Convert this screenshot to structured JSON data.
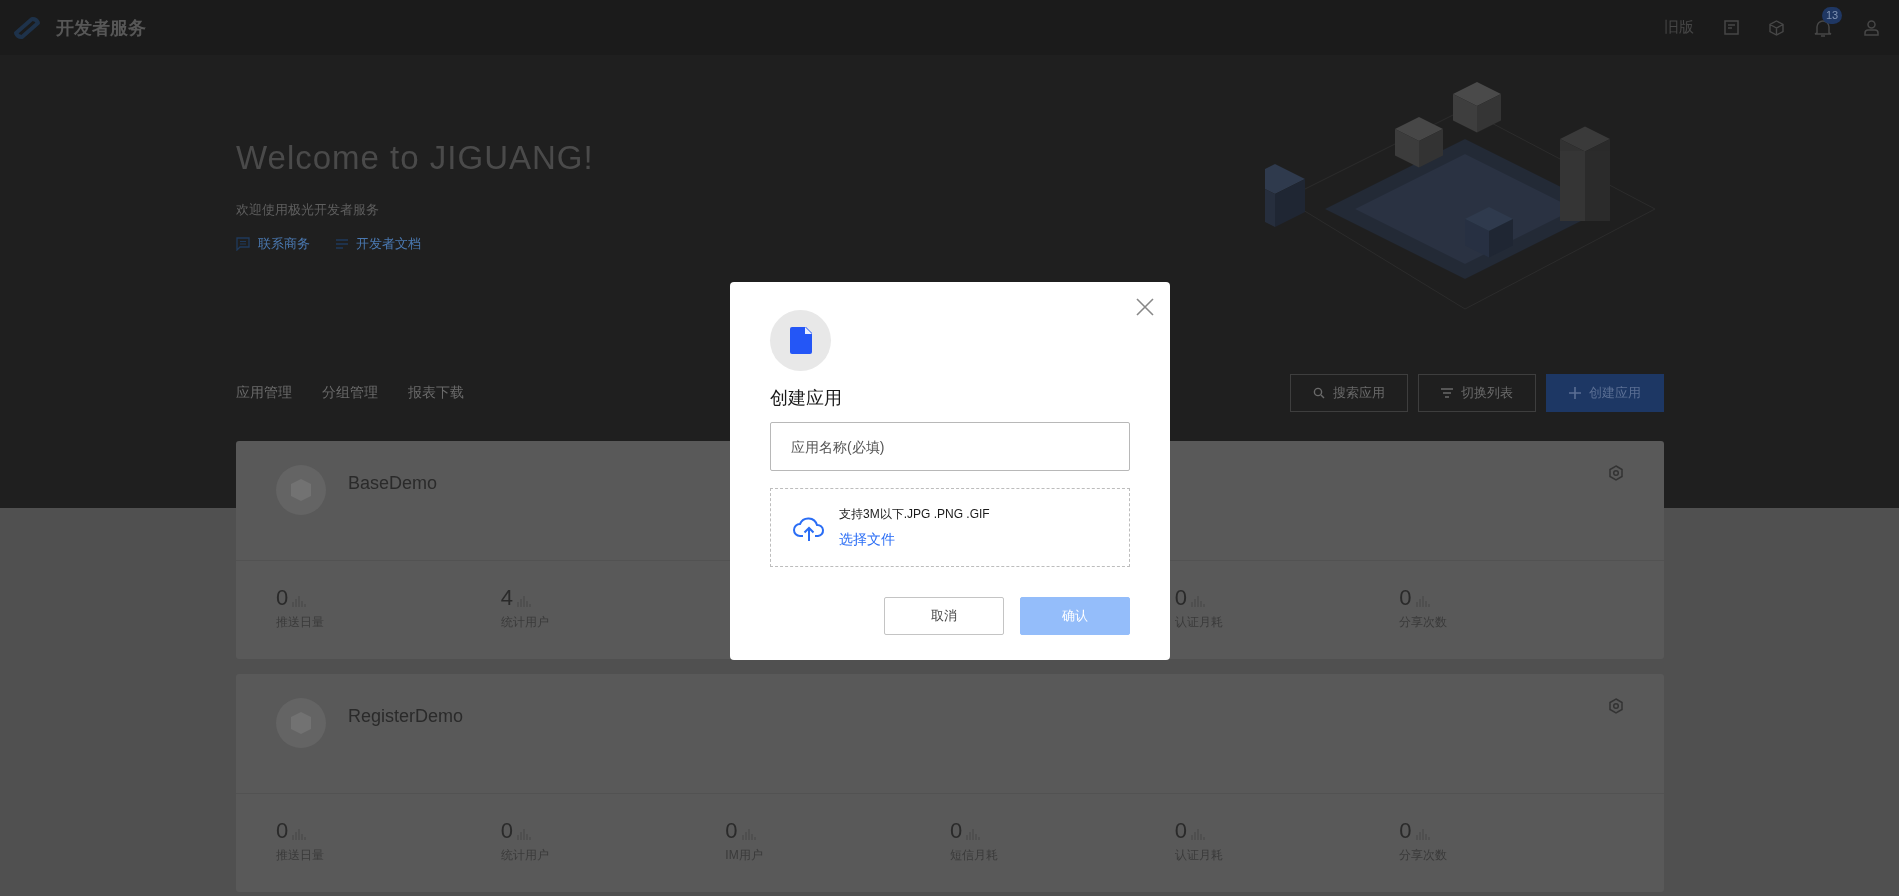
{
  "topbar": {
    "title": "开发者服务",
    "old_version": "旧版",
    "notification_count": "13"
  },
  "hero": {
    "title": "Welcome to JIGUANG!",
    "subtitle": "欢迎使用极光开发者服务",
    "links": [
      {
        "label": "联系商务",
        "kind": "chat"
      },
      {
        "label": "开发者文档",
        "kind": "doc"
      }
    ]
  },
  "tabs": [
    "应用管理",
    "分组管理",
    "报表下载"
  ],
  "actions": [
    {
      "label": "搜索应用",
      "kind": "search"
    },
    {
      "label": "切换列表",
      "kind": "list"
    },
    {
      "label": "创建应用",
      "kind": "create"
    }
  ],
  "apps": [
    {
      "name": "BaseDemo",
      "stats": [
        {
          "value": "0",
          "label": "推送日量"
        },
        {
          "value": "4",
          "label": "统计用户"
        }
      ],
      "stats_right": [
        {
          "value": "0",
          "label": "认证月耗"
        },
        {
          "value": "0",
          "label": "分享次数"
        }
      ]
    },
    {
      "name": "RegisterDemo",
      "stats": [
        {
          "value": "0",
          "label": "推送日量"
        },
        {
          "value": "0",
          "label": "统计用户"
        },
        {
          "value": "0",
          "label": "IM用户"
        },
        {
          "value": "0",
          "label": "短信月耗"
        },
        {
          "value": "0",
          "label": "认证月耗"
        },
        {
          "value": "0",
          "label": "分享次数"
        }
      ]
    }
  ],
  "dialog": {
    "title": "创建应用",
    "name_field": {
      "placeholder": "应用名称(必填)"
    },
    "upload": {
      "hint": "支持3M以下.JPG .PNG .GIF",
      "link": "选择文件"
    },
    "buttons": [
      {
        "label": "取消",
        "kind": "secondary",
        "disabled": false
      },
      {
        "label": "确认",
        "kind": "primary",
        "disabled": true
      }
    ]
  }
}
